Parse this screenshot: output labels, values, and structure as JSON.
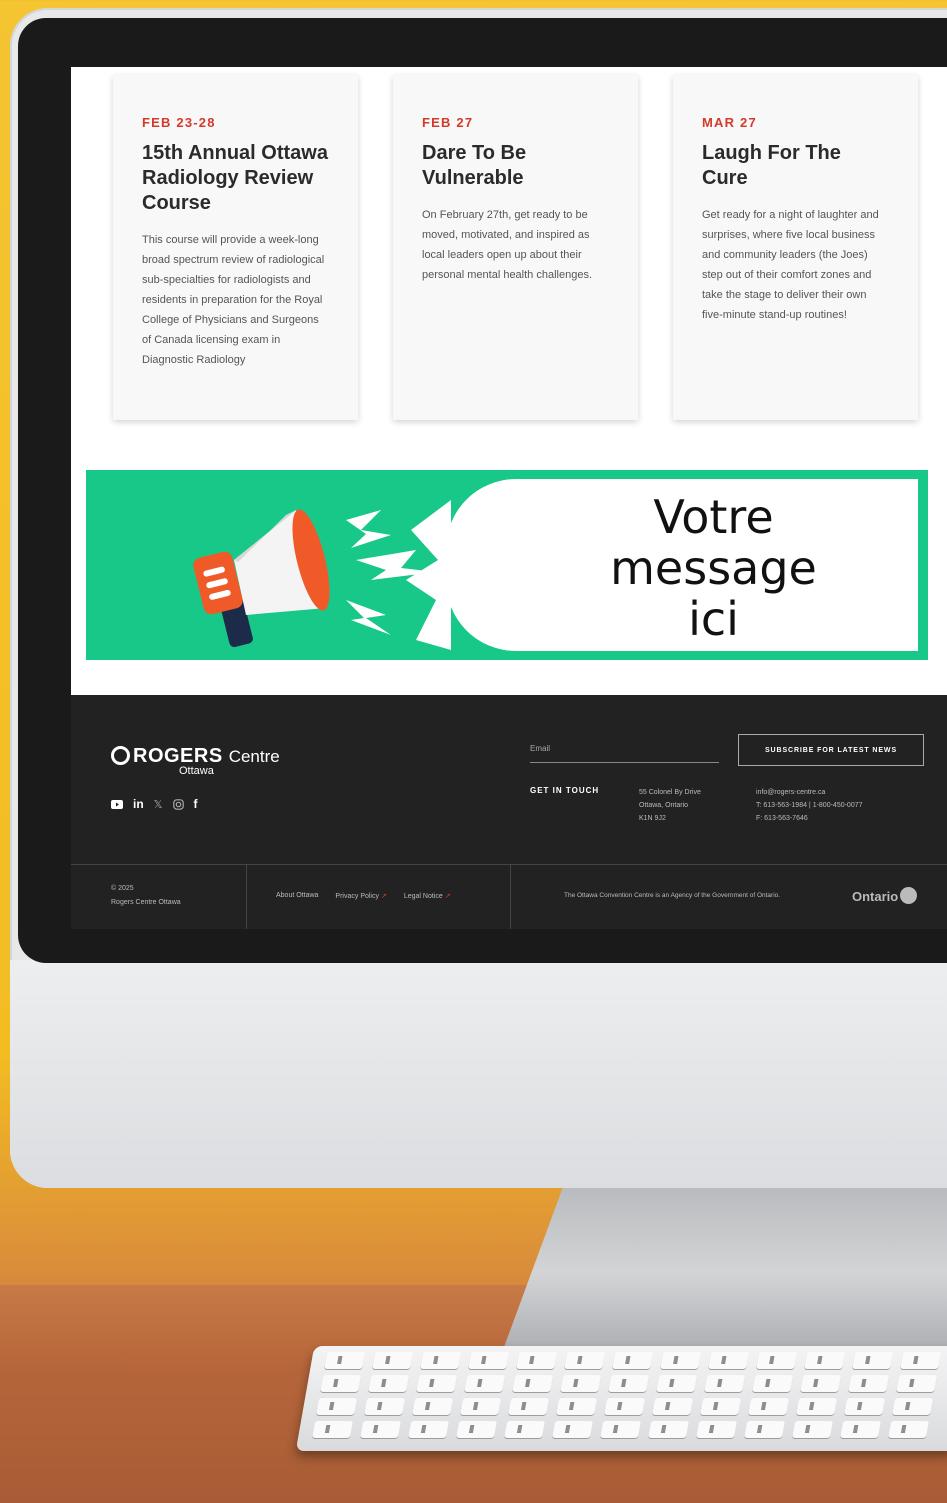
{
  "events": [
    {
      "date": "FEB 23-28",
      "title": "15th Annual Ottawa Radiology Review Course",
      "description": "This course will provide a week-long broad spectrum review of radiological sub-specialties for radiologists and residents in preparation for the Royal College of Physicians and Surgeons of Canada licensing exam in Diagnostic Radiology"
    },
    {
      "date": "FEB 27",
      "title": "Dare To Be Vulnerable",
      "description": "On February 27th, get ready to be moved, motivated, and inspired as local leaders open up about their personal mental health challenges."
    },
    {
      "date": "MAR 27",
      "title": "Laugh For The Cure",
      "description": "Get ready for a night of laughter and surprises, where five local business and community leaders (the Joes) step out of their comfort zones and take the stage to deliver their own five-minute stand-up routines!"
    }
  ],
  "banner": {
    "line1": "Votre",
    "line2": "message",
    "line3": "ici",
    "bg_color": "#18c888",
    "icon": "megaphone-icon"
  },
  "footer": {
    "logo_word": "ROGERS",
    "logo_centre": "Centre",
    "logo_city": "Ottawa",
    "socials": [
      "youtube-icon",
      "linkedin-icon",
      "x-icon",
      "instagram-icon",
      "facebook-icon"
    ],
    "email_placeholder": "Email",
    "subscribe_label": "SUBSCRIBE FOR LATEST NEWS",
    "get_in_touch": "GET IN TOUCH",
    "address_line1": "55 Colonel By Drive",
    "address_line2": "Ottawa, Ontario",
    "address_line3": "K1N 9J2",
    "contact_email": "info@rogers-centre.ca",
    "contact_phone": "T: 613-563-1984 | 1-800-450-0077",
    "contact_fax": "F: 613-563-7646",
    "copyright_year": "© 2025",
    "copyright_name": "Rogers Centre Ottawa",
    "links": [
      "About Ottawa",
      "Privacy Policy",
      "Legal Notice"
    ],
    "agency_text": "The Ottawa Convention Centre is an Agency of the Government of Ontario.",
    "ontario_label": "Ontario",
    "accent_color": "#d43a2c"
  }
}
